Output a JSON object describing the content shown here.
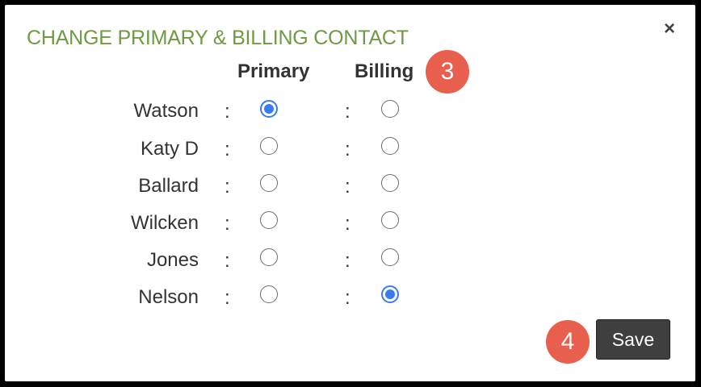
{
  "dialog": {
    "title": "CHANGE PRIMARY & BILLING CONTACT",
    "close_label": "×",
    "columns": {
      "primary": "Primary",
      "billing": "Billing"
    },
    "separator": ":",
    "rows": [
      {
        "name": "Watson",
        "primary": true,
        "billing": false
      },
      {
        "name": "Katy D",
        "primary": false,
        "billing": false
      },
      {
        "name": "Ballard",
        "primary": false,
        "billing": false
      },
      {
        "name": "Wilcken",
        "primary": false,
        "billing": false
      },
      {
        "name": "Jones",
        "primary": false,
        "billing": false
      },
      {
        "name": "Nelson",
        "primary": false,
        "billing": true
      }
    ],
    "save_label": "Save"
  },
  "annotations": {
    "badge_3": "3",
    "badge_4": "4"
  },
  "colors": {
    "title": "#6f9a43",
    "badge": "#e8604d",
    "radio_selected": "#3a7cf0",
    "save_button": "#3f3f3f"
  }
}
